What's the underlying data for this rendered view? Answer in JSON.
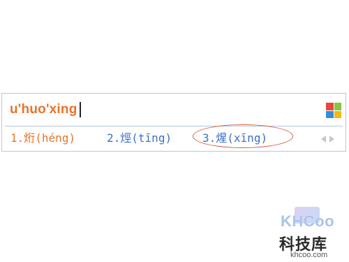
{
  "ime": {
    "composition": "u'huo'xing",
    "logo_colors": [
      "#e8483a",
      "#8dc43f",
      "#2e8fdc",
      "#f7b816"
    ],
    "candidates": [
      {
        "num": "1.",
        "char": "烆",
        "pinyin": "(héng)"
      },
      {
        "num": "2.",
        "char": "烴",
        "pinyin": "(tīng)"
      },
      {
        "num": "3.",
        "char": "煋",
        "pinyin": "(xīng)"
      }
    ],
    "pager": {
      "prev_icon": "arrow-left-icon",
      "next_icon": "arrow-right-icon"
    },
    "accent_color": "#e8742c",
    "candidate_color": "#3a72c4",
    "highlight_color": "#d45f3f"
  },
  "watermark": {
    "logo_text": "KHCoo",
    "cn_text": "科技库",
    "domain": "khcoo.com"
  }
}
